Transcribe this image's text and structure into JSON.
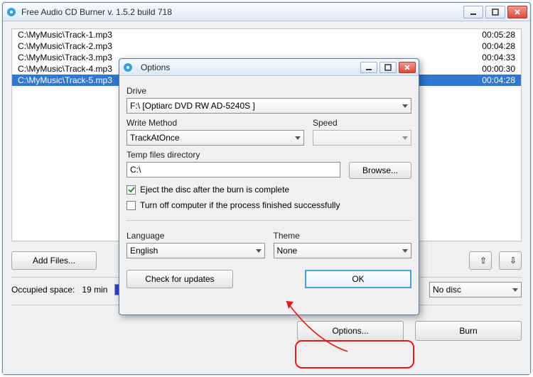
{
  "main": {
    "title": "Free Audio CD Burner  v. 1.5.2 build 718",
    "files": [
      {
        "path": "C:\\MyMusic\\Track-1.mp3",
        "duration": "00:05:28",
        "selected": false
      },
      {
        "path": "C:\\MyMusic\\Track-2.mp3",
        "duration": "00:04:28",
        "selected": false
      },
      {
        "path": "C:\\MyMusic\\Track-3.mp3",
        "duration": "00:04:33",
        "selected": false
      },
      {
        "path": "C:\\MyMusic\\Track-4.mp3",
        "duration": "00:00:30",
        "selected": false
      },
      {
        "path": "C:\\MyMusic\\Track-5.mp3",
        "duration": "00:04:28",
        "selected": true
      }
    ],
    "add_files": "Add Files...",
    "occupied_label": "Occupied space:",
    "occupied_value": "19 min",
    "disc_value": "No disc",
    "options_btn": "Options...",
    "burn_btn": "Burn"
  },
  "dialog": {
    "title": "Options",
    "drive_label": "Drive",
    "drive_value": "F:\\ [Optiarc DVD RW AD-5240S ]",
    "write_label": "Write Method",
    "write_value": "TrackAtOnce",
    "speed_label": "Speed",
    "speed_value": "",
    "temp_label": "Temp files directory",
    "temp_value": "C:\\",
    "browse": "Browse...",
    "eject_label": "Eject the disc after the burn is complete",
    "eject_checked": true,
    "turnoff_label": "Turn off computer if the process finished successfully",
    "turnoff_checked": false,
    "lang_label": "Language",
    "lang_value": "English",
    "theme_label": "Theme",
    "theme_value": "None",
    "updates": "Check for updates",
    "ok": "OK"
  }
}
